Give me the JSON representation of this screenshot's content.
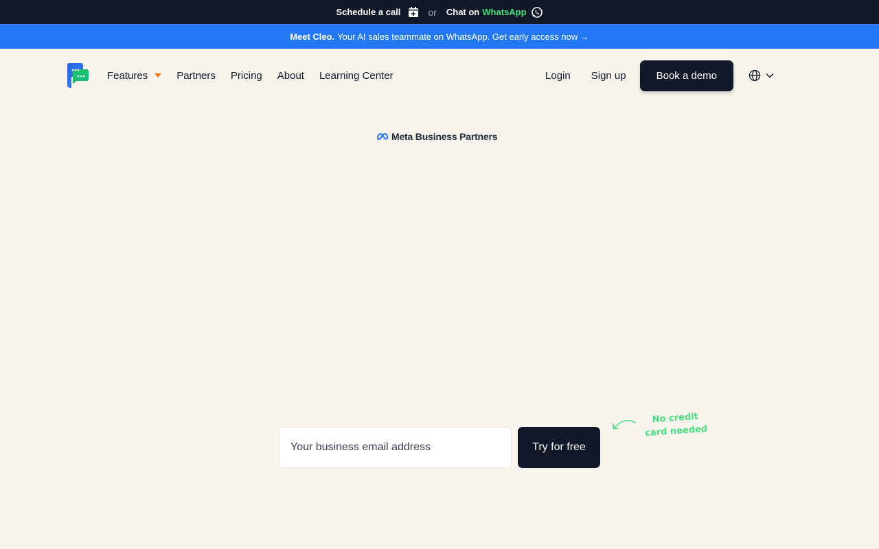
{
  "topbar": {
    "schedule_label": "Schedule a call",
    "or_label": "or",
    "chat_prefix": "Chat on",
    "chat_brand": "WhatsApp"
  },
  "announcement": {
    "bold": "Meet Cleo.",
    "text": "Your AI sales teammate on WhatsApp. Get early access now →"
  },
  "nav": {
    "items": [
      {
        "label": "Features"
      },
      {
        "label": "Partners"
      },
      {
        "label": "Pricing"
      },
      {
        "label": "About"
      },
      {
        "label": "Learning Center"
      }
    ],
    "login": "Login",
    "signup": "Sign up",
    "demo": "Book a demo"
  },
  "badge": {
    "text": "Meta Business Partners"
  },
  "form": {
    "email_placeholder": "Your business email address",
    "email_value": "",
    "submit_label": "Try for free",
    "note_line1": "No credit",
    "note_line2": "card needed"
  },
  "colors": {
    "dark": "#111827",
    "blue": "#2379f5",
    "green": "#4ade80",
    "orange": "#f97316",
    "page_bg": "#f8f5ee"
  },
  "icons": [
    "calendar-plus-icon",
    "whatsapp-icon",
    "brand-logo",
    "chevron-down-icon",
    "globe-icon",
    "meta-logo-icon",
    "curved-arrow-icon"
  ]
}
